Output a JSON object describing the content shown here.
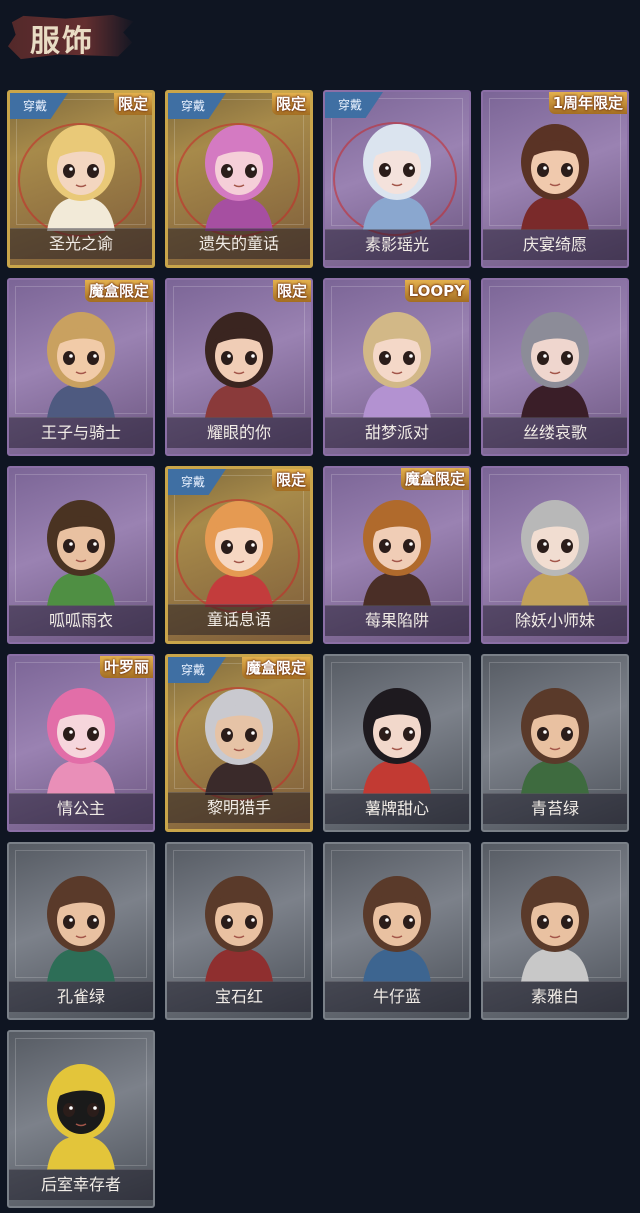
{
  "header": {
    "title": "服饰"
  },
  "colors": {
    "background": "#0f1522",
    "gold_frame": "#c9a54a",
    "purple_frame": "#8b6fa6",
    "grey_frame": "#7a8088",
    "wear_tag": "#3f6fa3"
  },
  "costumes": [
    {
      "name": "圣光之谕",
      "badge": "限定",
      "wear": "穿戴",
      "tier": "gold",
      "hair": "#e9c978",
      "skin": "#f3d6c0",
      "outfit": "#f2ead8"
    },
    {
      "name": "遗失的童话",
      "badge": "限定",
      "wear": "穿戴",
      "tier": "gold",
      "hair": "#d47ac2",
      "skin": "#f5cfd8",
      "outfit": "#a64fa1"
    },
    {
      "name": "素影瑶光",
      "badge": "",
      "wear": "穿戴",
      "tier": "purple",
      "hair": "#dbe4ef",
      "skin": "#f4e2dc",
      "outfit": "#8aa7cf"
    },
    {
      "name": "庆宴绮愿",
      "badge": "1周年限定",
      "wear": "",
      "tier": "purple",
      "hair": "#5a3325",
      "skin": "#f0c9ad",
      "outfit": "#7a2a2a"
    },
    {
      "name": "王子与骑士",
      "badge": "魔盒限定",
      "wear": "",
      "tier": "purple",
      "hair": "#c9a160",
      "skin": "#f1cba8",
      "outfit": "#4e5a80"
    },
    {
      "name": "耀眼的你",
      "badge": "限定",
      "wear": "",
      "tier": "purple",
      "hair": "#3a2520",
      "skin": "#f0cdb6",
      "outfit": "#8a3a3a"
    },
    {
      "name": "甜梦派对",
      "badge": "LOOPY",
      "wear": "",
      "tier": "purple",
      "hair": "#d2b887",
      "skin": "#f4d8c8",
      "outfit": "#b392d1"
    },
    {
      "name": "丝缕哀歌",
      "badge": "",
      "wear": "",
      "tier": "purple",
      "hair": "#8c8c98",
      "skin": "#efd6ce",
      "outfit": "#3a1e28"
    },
    {
      "name": "呱呱雨衣",
      "badge": "",
      "wear": "",
      "tier": "purple",
      "hair": "#4a3322",
      "skin": "#e9c1a1",
      "outfit": "#4f8f43"
    },
    {
      "name": "童话息语",
      "badge": "限定",
      "wear": "穿戴",
      "tier": "gold",
      "hair": "#e59a52",
      "skin": "#f6d7c2",
      "outfit": "#c33c3c"
    },
    {
      "name": "莓果陷阱",
      "badge": "魔盒限定",
      "wear": "",
      "tier": "purple",
      "hair": "#b06a2c",
      "skin": "#f0cdb6",
      "outfit": "#4a2e26"
    },
    {
      "name": "除妖小师妹",
      "badge": "",
      "wear": "",
      "tier": "purple",
      "hair": "#b8b8b8",
      "skin": "#f1ddd1",
      "outfit": "#c2a15a"
    },
    {
      "name": "情公主",
      "badge": "叶罗丽",
      "wear": "",
      "tier": "purple",
      "hair": "#e26ea8",
      "skin": "#f6d6dc",
      "outfit": "#e98fb8"
    },
    {
      "name": "黎明猎手",
      "badge": "魔盒限定",
      "wear": "穿戴",
      "tier": "gold",
      "hair": "#c9c9cf",
      "skin": "#e6c3a6",
      "outfit": "#3a2a2a"
    },
    {
      "name": "薯牌甜心",
      "badge": "",
      "wear": "",
      "tier": "grey",
      "hair": "#1e1a1f",
      "skin": "#f2d8cb",
      "outfit": "#c23a33"
    },
    {
      "name": "青苔绿",
      "badge": "",
      "wear": "",
      "tier": "grey",
      "hair": "#5a3a2a",
      "skin": "#e9c1a1",
      "outfit": "#3e6b3f"
    },
    {
      "name": "孔雀绿",
      "badge": "",
      "wear": "",
      "tier": "grey",
      "hair": "#5a3a2a",
      "skin": "#e9c1a1",
      "outfit": "#2d6e57"
    },
    {
      "name": "宝石红",
      "badge": "",
      "wear": "",
      "tier": "grey",
      "hair": "#5a3a2a",
      "skin": "#e9c1a1",
      "outfit": "#8f2f2f"
    },
    {
      "name": "牛仔蓝",
      "badge": "",
      "wear": "",
      "tier": "grey",
      "hair": "#5a3a2a",
      "skin": "#e9c1a1",
      "outfit": "#3d6590"
    },
    {
      "name": "素雅白",
      "badge": "",
      "wear": "",
      "tier": "grey",
      "hair": "#5a3a2a",
      "skin": "#e9c1a1",
      "outfit": "#c8c8c8"
    },
    {
      "name": "后室幸存者",
      "badge": "",
      "wear": "",
      "tier": "grey",
      "hair": "#e3c53a",
      "skin": "#1a1a1a",
      "outfit": "#e3c53a"
    }
  ]
}
